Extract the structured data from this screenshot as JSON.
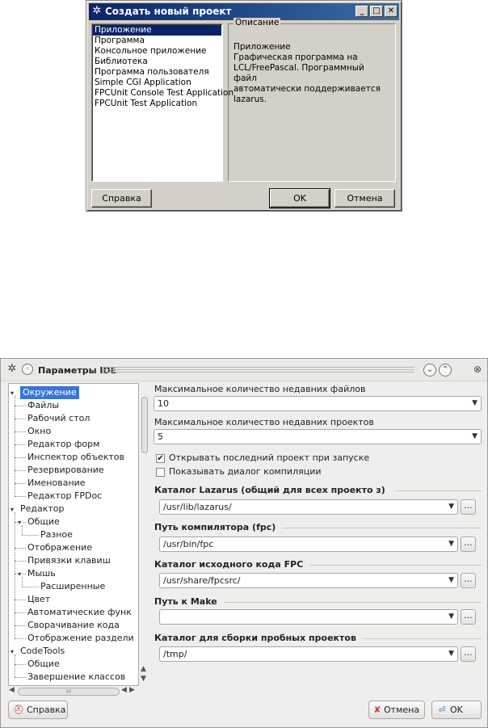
{
  "new_project": {
    "title": "Создать новый проект",
    "items": [
      "Приложение",
      "Программа",
      "Консольное приложение",
      "Библиотека",
      "Программа пользователя",
      "Simple CGI Application",
      "FPCUnit Console Test Application",
      "FPCUnit Test Application"
    ],
    "selected_index": 0,
    "description_label": "Описание",
    "description_lines": [
      "Приложение",
      "Графическая программа на",
      "LCL/FreePascal. Программный файл",
      "автоматически поддерживается",
      "lazarus."
    ],
    "help_button": "Справка",
    "ok_button": "OK",
    "cancel_button": "Отмена"
  },
  "ide_options": {
    "title": "Параметры IDE",
    "tree": [
      {
        "label": "Окружение",
        "level": 0,
        "expanded": true,
        "selected": true
      },
      {
        "label": "Файлы",
        "level": 1
      },
      {
        "label": "Рабочий стол",
        "level": 1
      },
      {
        "label": "Окно",
        "level": 1
      },
      {
        "label": "Редактор форм",
        "level": 1
      },
      {
        "label": "Инспектор объектов",
        "level": 1
      },
      {
        "label": "Резервирование",
        "level": 1
      },
      {
        "label": "Именование",
        "level": 1
      },
      {
        "label": "Редактор FPDoc",
        "level": 1
      },
      {
        "label": "Редактор",
        "level": 0,
        "expanded": true
      },
      {
        "label": "Общие",
        "level": 1,
        "expanded": true
      },
      {
        "label": "Разное",
        "level": 2
      },
      {
        "label": "Отображение",
        "level": 1
      },
      {
        "label": "Привязки клавиш",
        "level": 1
      },
      {
        "label": "Мышь",
        "level": 1,
        "expanded": true
      },
      {
        "label": "Расширенные",
        "level": 2
      },
      {
        "label": "Цвет",
        "level": 1
      },
      {
        "label": "Автоматические функ",
        "level": 1
      },
      {
        "label": "Сворачивание кода",
        "level": 1
      },
      {
        "label": "Отображение раздели",
        "level": 1
      },
      {
        "label": "CodeTools",
        "level": 0,
        "expanded": true
      },
      {
        "label": "Общие",
        "level": 1
      },
      {
        "label": "Завершение классов",
        "level": 1
      }
    ],
    "max_recent_files_label": "Максимальное количество недавних файлов",
    "max_recent_files_value": "10",
    "max_recent_projects_label": "Максимальное количество недавних проектов",
    "max_recent_projects_value": "5",
    "open_last_project_label": "Открывать последний проект при запуске",
    "open_last_project_checked": true,
    "show_compile_dialog_label": "Показывать диалог компиляции",
    "show_compile_dialog_checked": false,
    "lazarus_dir_label": "Каталог Lazarus (общий для всех проекто з)",
    "lazarus_dir_value": "/usr/lib/lazarus/",
    "compiler_path_label": "Путь компилятора (fpc)",
    "compiler_path_value": "/usr/bin/fpc",
    "fpc_source_label": "Каталог исходного кода FPC",
    "fpc_source_value": "/usr/share/fpcsrc/",
    "make_path_label": "Путь к Make",
    "make_path_value": "",
    "test_build_dir_label": "Каталог для сборки пробных проектов",
    "test_build_dir_value": "/tmp/",
    "browse_label": "...",
    "help_button": "Справка",
    "cancel_button": "Отмена",
    "ok_button": "OK"
  }
}
